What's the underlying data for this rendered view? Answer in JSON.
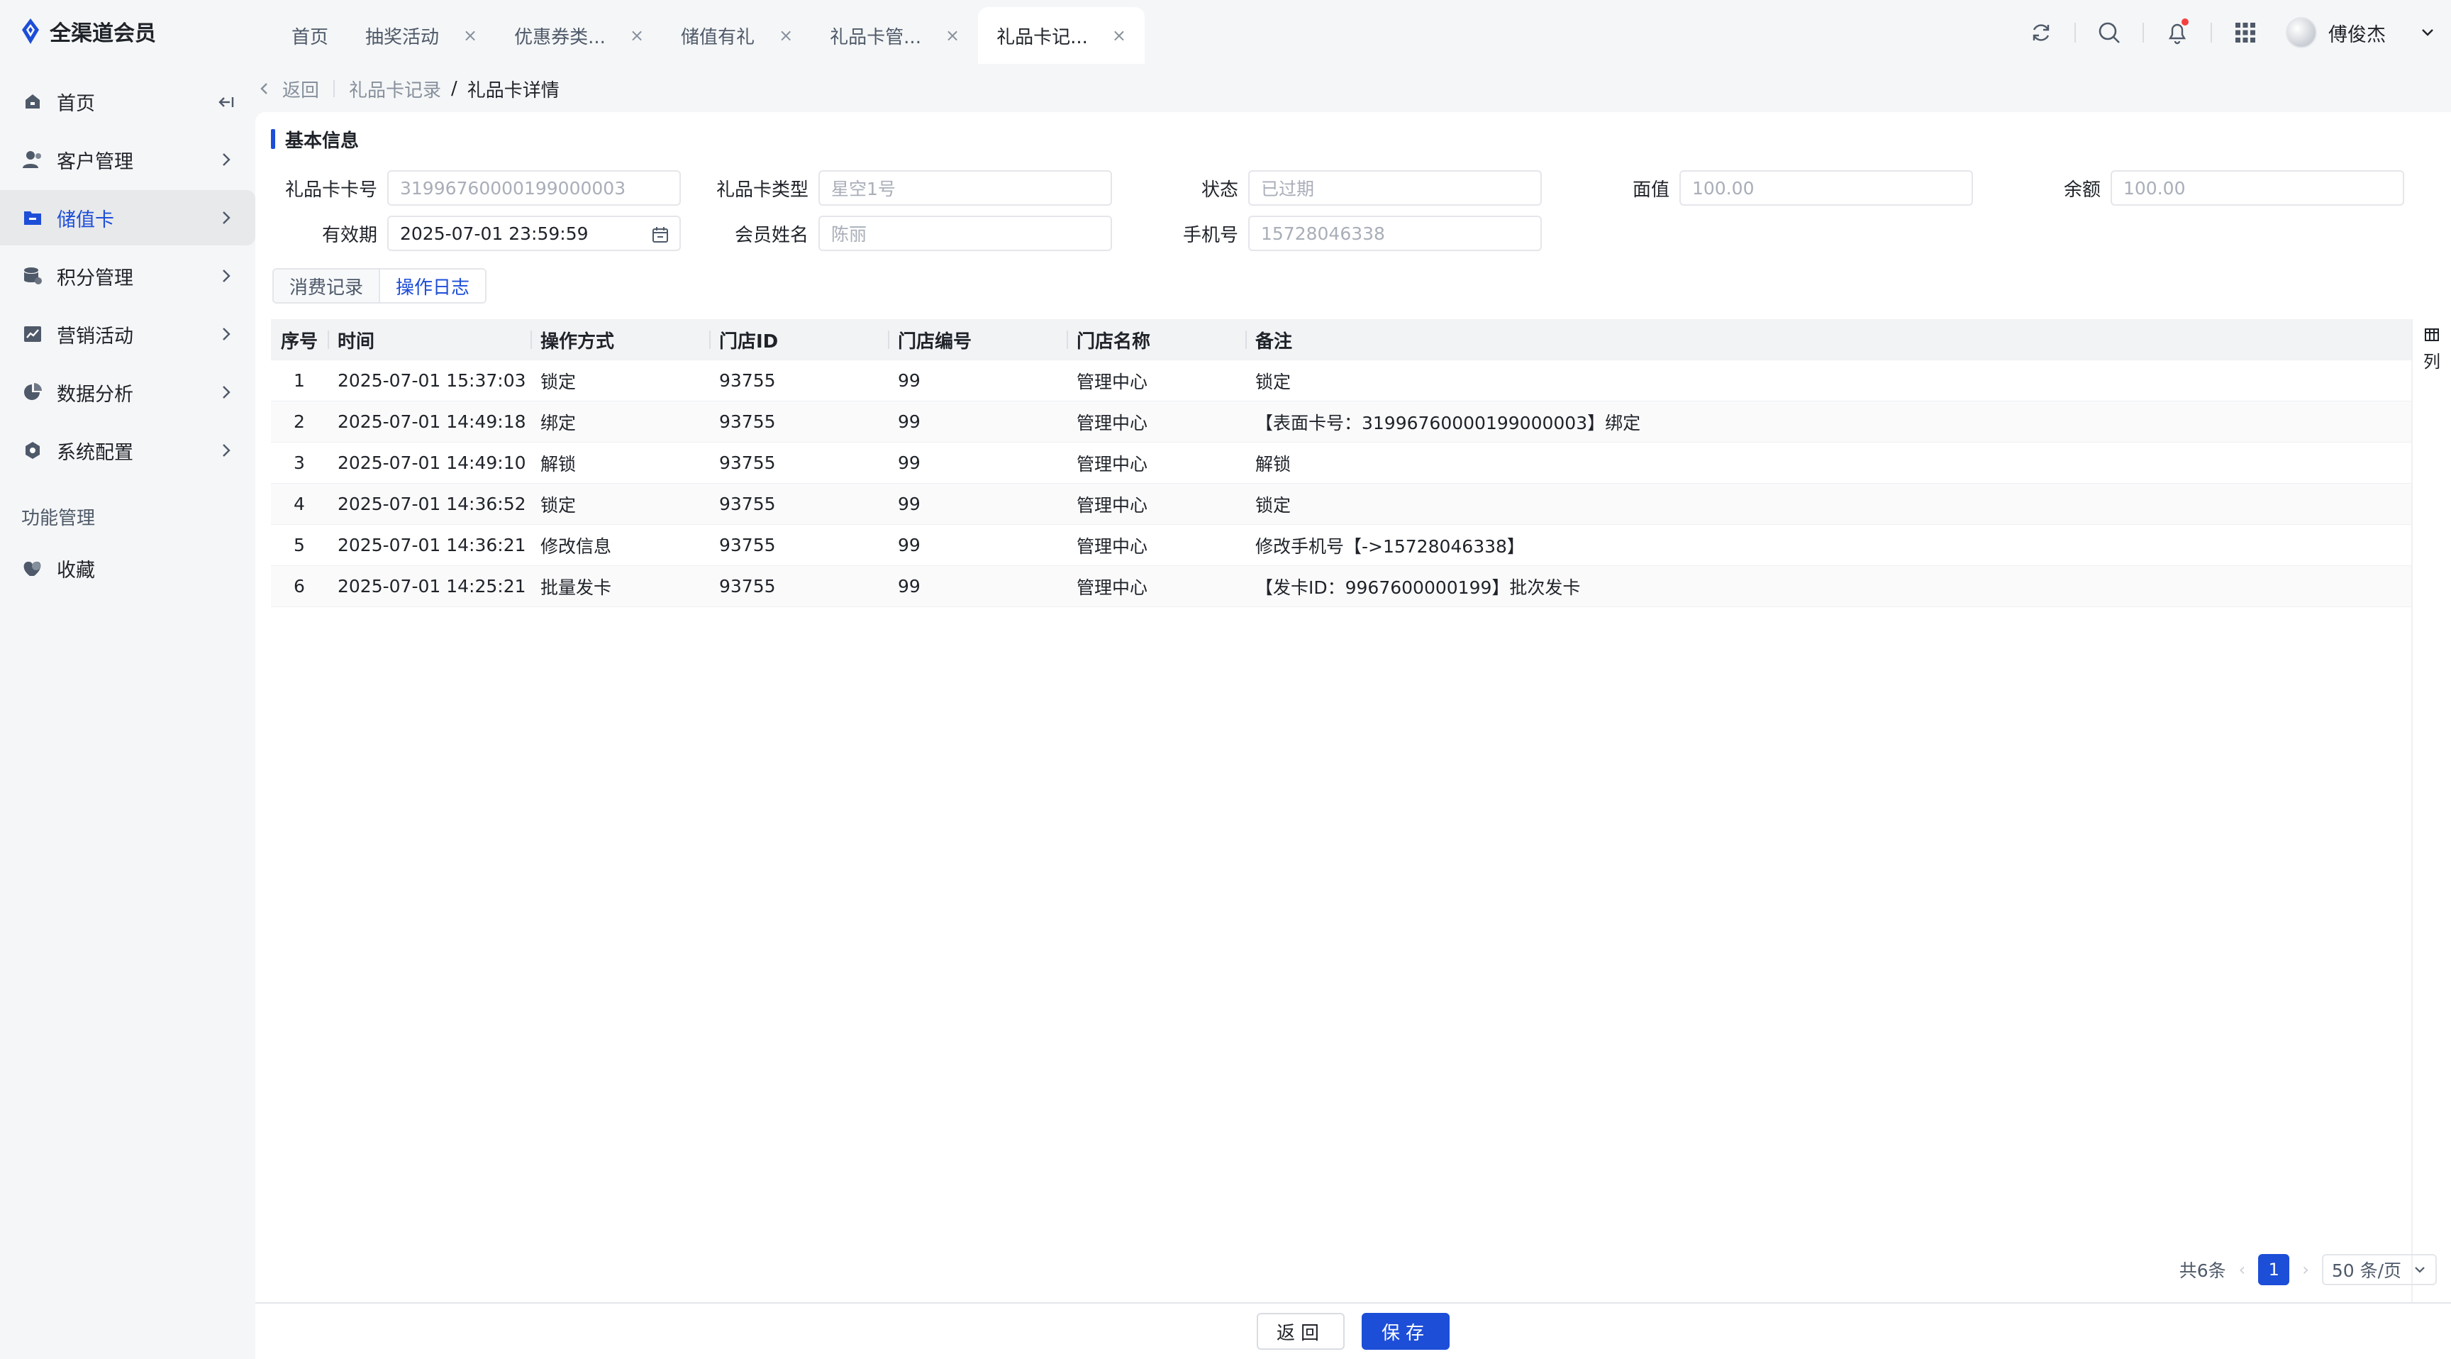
{
  "app": {
    "name": "全渠道会员",
    "brand_color": "#1d4ed8"
  },
  "tabs": [
    {
      "label": "首页",
      "closable": false
    },
    {
      "label": "抽奖活动",
      "closable": true
    },
    {
      "label": "优惠券类...",
      "closable": true
    },
    {
      "label": "储值有礼",
      "closable": true
    },
    {
      "label": "礼品卡管...",
      "closable": true
    },
    {
      "label": "礼品卡记...",
      "closable": true,
      "active": true
    }
  ],
  "tab_close_glyph": "×",
  "header": {
    "user_name": "傅俊杰",
    "icons": [
      "refresh-icon",
      "search-icon",
      "bell-icon",
      "apps-grid-icon",
      "chevron-down-icon"
    ]
  },
  "sidebar": {
    "items": [
      {
        "label": "首页",
        "icon": "home-icon"
      },
      {
        "label": "客户管理",
        "icon": "user-icon"
      },
      {
        "label": "储值卡",
        "icon": "card-icon",
        "active": true
      },
      {
        "label": "积分管理",
        "icon": "points-icon"
      },
      {
        "label": "营销活动",
        "icon": "chart-icon"
      },
      {
        "label": "数据分析",
        "icon": "pie-icon"
      },
      {
        "label": "系统配置",
        "icon": "settings-icon"
      }
    ],
    "group_label": "功能管理",
    "extra_items": [
      {
        "label": "收藏",
        "icon": "heart-icon"
      }
    ]
  },
  "breadcrumb": {
    "back": "返回",
    "parent": "礼品卡记录",
    "separator": "/",
    "current": "礼品卡详情"
  },
  "basic_info": {
    "title": "基本信息",
    "card_no_label": "礼品卡卡号",
    "card_no": "31996760000199000003",
    "card_type_label": "礼品卡类型",
    "card_type": "星空1号",
    "status_label": "状态",
    "status": "已过期",
    "face_value_label": "面值",
    "face_value": "100.00",
    "balance_label": "余额",
    "balance": "100.00",
    "expiry_label": "有效期",
    "expiry": "2025-07-01 23:59:59",
    "member_name_label": "会员姓名",
    "member_name": "陈丽",
    "phone_label": "手机号",
    "phone": "15728046338"
  },
  "subtabs": [
    "消费记录",
    "操作日志"
  ],
  "table": {
    "headers": [
      "序号",
      "时间",
      "操作方式",
      "门店ID",
      "门店编号",
      "门店名称",
      "备注"
    ],
    "rows": [
      [
        "1",
        "2025-07-01 15:37:03",
        "锁定",
        "93755",
        "99",
        "管理中心",
        "锁定"
      ],
      [
        "2",
        "2025-07-01 14:49:18",
        "绑定",
        "93755",
        "99",
        "管理中心",
        "【表面卡号：31996760000199000003】绑定"
      ],
      [
        "3",
        "2025-07-01 14:49:10",
        "解锁",
        "93755",
        "99",
        "管理中心",
        "解锁"
      ],
      [
        "4",
        "2025-07-01 14:36:52",
        "锁定",
        "93755",
        "99",
        "管理中心",
        "锁定"
      ],
      [
        "5",
        "2025-07-01 14:36:21",
        "修改信息",
        "93755",
        "99",
        "管理中心",
        "修改手机号【->15728046338】"
      ],
      [
        "6",
        "2025-07-01 14:25:21",
        "批量发卡",
        "93755",
        "99",
        "管理中心",
        "【发卡ID：9967600000199】批次发卡"
      ]
    ],
    "column_tool_label": "列"
  },
  "pager": {
    "total": "共6条",
    "page": "1",
    "page_size": "50 条/页"
  },
  "footer": {
    "back": "返回",
    "save": "保存"
  }
}
